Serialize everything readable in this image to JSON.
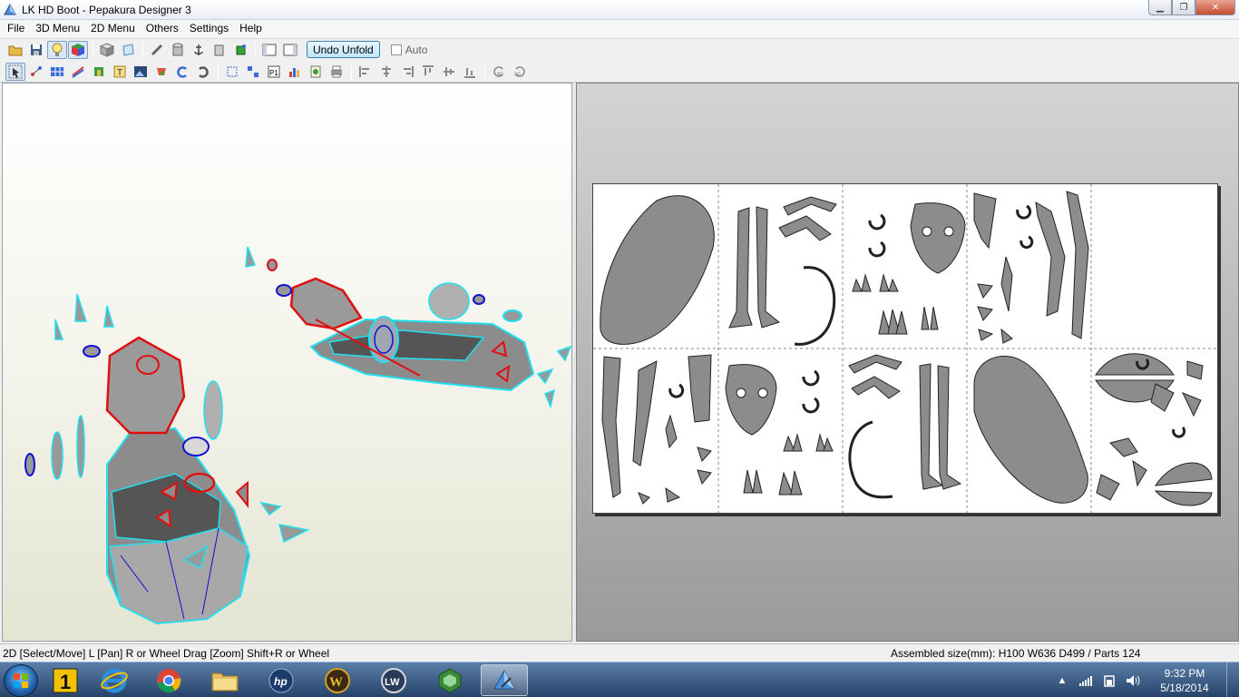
{
  "window": {
    "title": "LK HD Boot - Pepakura Designer 3"
  },
  "menu": [
    "File",
    "3D Menu",
    "2D Menu",
    "Others",
    "Settings",
    "Help"
  ],
  "toolbar": {
    "undo_unfold": "Undo Unfold",
    "auto_label": "Auto"
  },
  "status": {
    "left": "2D [Select/Move] L [Pan] R or Wheel Drag [Zoom] Shift+R or Wheel",
    "right": "Assembled size(mm): H100 W636 D499 / Parts 124"
  },
  "taskbar": {
    "pinned": [
      "start-orb",
      "1-app",
      "internet-explorer",
      "chrome",
      "file-explorer",
      "hp-app",
      "warcraft",
      "livewire",
      "green-hex-app",
      "pepakura"
    ],
    "clock_time": "9:32 PM",
    "clock_date": "5/18/2014"
  },
  "colors": {
    "cut_line": "#1fe0f0",
    "mountain": "#e01010",
    "valley": "#1010d0",
    "part_fill": "#8c8c8c"
  }
}
